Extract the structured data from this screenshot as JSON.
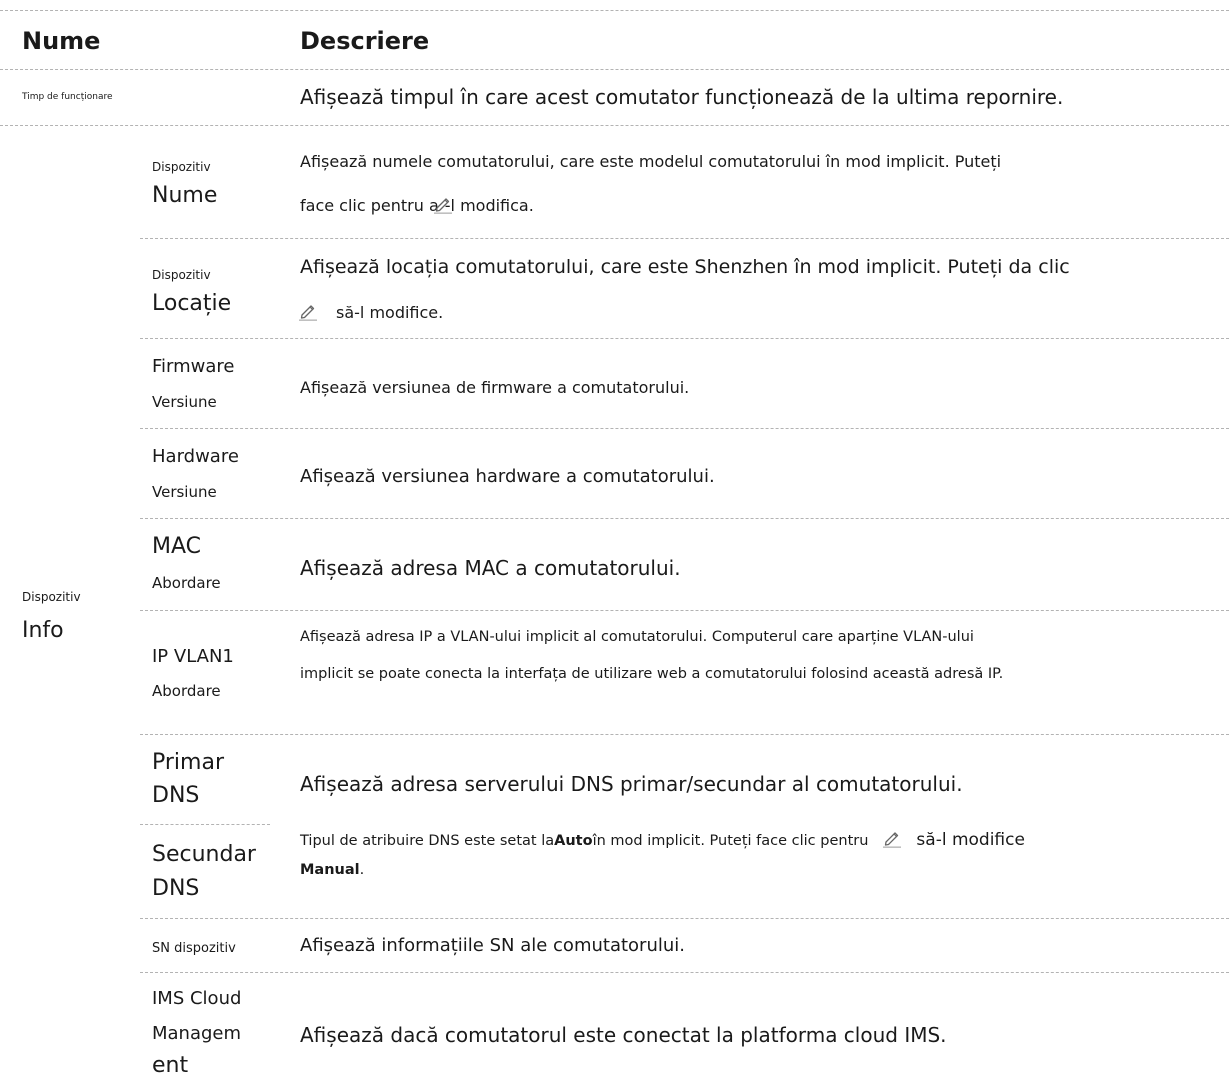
{
  "header": {
    "name": "Nume",
    "description": "Descriere"
  },
  "uptime": {
    "name": "Timp de funcționare",
    "desc": "Afișează timpul în care acest comutator funcționează de la ultima repornire."
  },
  "group": {
    "label_small": "Dispozitiv",
    "label_large": "Info"
  },
  "rows": {
    "device_name": {
      "small": "Dispozitiv",
      "large": "Nume",
      "desc_1": "Afișează numele comutatorului, care este modelul comutatorului în mod implicit. Puteți",
      "desc_2a": "face clic pentru a",
      "desc_2b": "-l modifica."
    },
    "device_location": {
      "small": "Dispozitiv",
      "large": "Locație",
      "desc_1": "Afișează locația comutatorului, care este Shenzhen în mod implicit. Puteți da clic",
      "desc_2": "să-l modifice."
    },
    "firmware": {
      "line1": "Firmware",
      "line2": "Versiune",
      "desc": "Afișează versiunea de firmware a comutatorului."
    },
    "hardware": {
      "line1": "Hardware",
      "line2": "Versiune",
      "desc": "Afișează versiunea hardware a comutatorului."
    },
    "mac": {
      "line1": "MAC",
      "line2": "Abordare",
      "desc": "Afișează adresa MAC a comutatorului."
    },
    "ip": {
      "line1": "IP VLAN1",
      "line2": "Abordare",
      "desc_1": "Afișează adresa IP a VLAN-ului implicit al comutatorului. Computerul care aparține VLAN-ului",
      "desc_2": "implicit se poate conecta la interfața de utilizare web a comutatorului folosind această adresă IP."
    },
    "dns_primary": {
      "line1": "Primar",
      "line2": "DNS",
      "desc": "Afișează adresa serverului DNS primar/secundar al comutatorului."
    },
    "dns_secondary": {
      "line1": "Secundar",
      "line2": "DNS",
      "desc_a": "Tipul de atribuire DNS este setat la",
      "desc_bold1": "Auto",
      "desc_b": "în mod implicit. Puteți face clic pentru",
      "desc_c": "să-l modifice",
      "desc_bold2": "Manual",
      "desc_end": "."
    },
    "sn": {
      "name": "SN dispozitiv",
      "desc": "Afișează informațiile SN ale comutatorului."
    },
    "ims": {
      "line1": "IMS Cloud",
      "line2": "Managem",
      "line3": "ent",
      "desc": "Afișează dacă comutatorul este conectat la platforma cloud IMS."
    }
  },
  "icons": {
    "edit": "pencil-edit-icon"
  },
  "colors": {
    "pencil": "#666666",
    "underline": "#b0b0b0",
    "rule": "#b3b3b3"
  }
}
